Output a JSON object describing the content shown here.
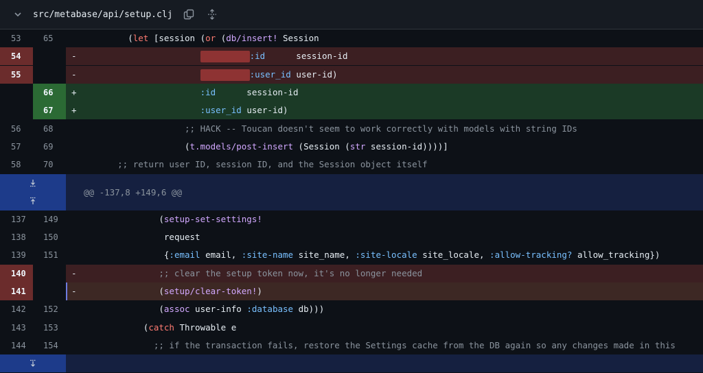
{
  "file": {
    "path": "src/metabase/api/setup.clj"
  },
  "hunk": {
    "header": "@@ -137,8 +149,6 @@"
  },
  "lines1": [
    {
      "o": "53",
      "n": "65"
    },
    {
      "o": "54",
      "n": ""
    },
    {
      "o": "55",
      "n": ""
    },
    {
      "o": "",
      "n": "66"
    },
    {
      "o": "",
      "n": "67"
    },
    {
      "o": "56",
      "n": "68"
    },
    {
      "o": "57",
      "n": "69"
    },
    {
      "o": "58",
      "n": "70"
    }
  ],
  "lines2": [
    {
      "o": "137",
      "n": "149"
    },
    {
      "o": "138",
      "n": "150"
    },
    {
      "o": "139",
      "n": "151"
    },
    {
      "o": "140",
      "n": ""
    },
    {
      "o": "141",
      "n": ""
    },
    {
      "o": "142",
      "n": "152"
    },
    {
      "o": "143",
      "n": "153"
    },
    {
      "o": "144",
      "n": "154"
    }
  ],
  "tokens": {
    "r1_let": "let",
    "r1_a": " [session (",
    "r1_or": "or",
    "r1_b": " (",
    "r1_ins": "db/insert!",
    "r1_c": " Session",
    "r2_mark": "-",
    "r2_kw": ":id",
    "r2_val": "      session-id",
    "r3_mark": "-",
    "r3_kw": ":user_id",
    "r3_val": " user-id)",
    "r4_mark": "+",
    "r4_kw": ":id",
    "r4_val": "      session-id",
    "r5_mark": "+",
    "r5_kw": ":user_id",
    "r5_val": " user-id)",
    "r6_comment": ";; HACK -- Toucan doesn't seem to work correctly with models with string IDs",
    "r7_fn": "t.models/post-insert",
    "r7_a": " (Session (",
    "r7_str": "str",
    "r7_b": " session-id))))]",
    "r8_comment": ";; return user ID, session ID, and the Session object itself",
    "s1_fn": "setup-set-settings!",
    "s2_text": "request",
    "s3_k1": ":email",
    "s3_v1": " email, ",
    "s3_k2": ":site-name",
    "s3_v2": " site_name, ",
    "s3_k3": ":site-locale",
    "s3_v3": " site_locale, ",
    "s3_k4": ":allow-tracking?",
    "s3_v4": " allow_tracking})",
    "s4_mark": "-",
    "s4_comment": ";; clear the setup token now, it's no longer needed",
    "s5_mark": "-",
    "s5_fn": "setup/clear-token!",
    "s6_a": "assoc",
    "s6_b": " user-info ",
    "s6_kw": ":database",
    "s6_c": " db)))",
    "s7_catch": "catch",
    "s7_rest": " Throwable e",
    "s8_comment": ";; if the transaction fails, restore the Settings cache from the DB again so any changes made in this"
  },
  "icons": [
    "chevron-down-icon",
    "copy-icon",
    "expand-all-icon",
    "expand-down-icon",
    "expand-up-icon"
  ]
}
